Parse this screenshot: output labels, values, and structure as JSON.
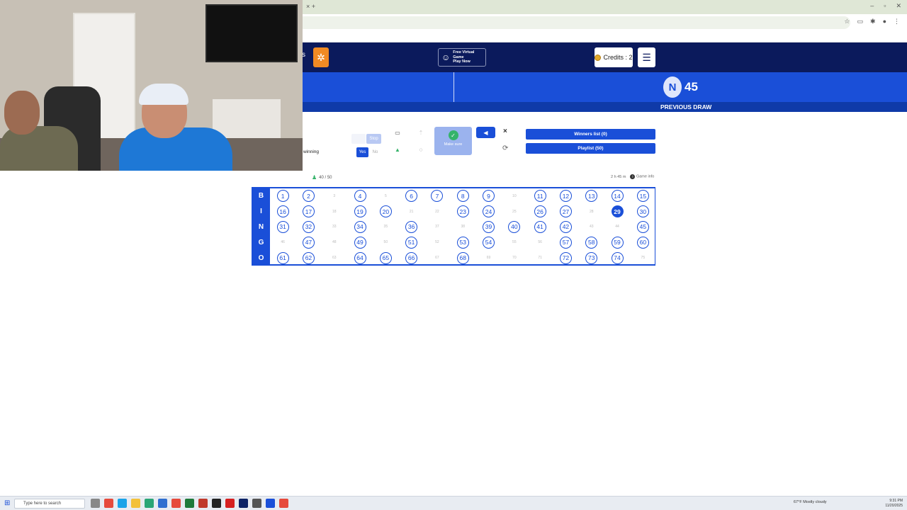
{
  "browser": {
    "tab_controls": "× +",
    "window_controls": [
      "–",
      "▫",
      "✕"
    ]
  },
  "header": {
    "free_game_line1": "Free Virtual Game",
    "free_game_line2": "Play Now",
    "credits_label": "Credits : 2",
    "menu_icon": "hamburger-icon",
    "cut_text": "s"
  },
  "draw": {
    "previous_letter": "N",
    "previous_number": "45",
    "previous_label": "PREVIOUS DRAW"
  },
  "controls": {
    "winning_label": "winning",
    "stop_label": "Stop",
    "yes_label": "Yes",
    "no_label": "No",
    "make_sure_label": "Make sure",
    "close_label": "×",
    "winners_list": "Winners list (0)",
    "playlist": "Playlist (50)",
    "players_count": "40 / 50",
    "time_label": "2 h 45 m",
    "game_info": "Game info"
  },
  "board": {
    "current": 29,
    "rows": [
      {
        "letter": "B",
        "numbers": [
          1,
          2,
          3,
          4,
          5,
          6,
          7,
          8,
          9,
          10,
          11,
          12,
          13,
          14,
          15
        ],
        "called": [
          1,
          2,
          4,
          6,
          7,
          8,
          9,
          11,
          12,
          13,
          14,
          15
        ]
      },
      {
        "letter": "I",
        "numbers": [
          16,
          17,
          18,
          19,
          20,
          21,
          22,
          23,
          24,
          25,
          26,
          27,
          28,
          29,
          30
        ],
        "called": [
          16,
          17,
          19,
          20,
          23,
          24,
          26,
          27,
          29,
          30
        ]
      },
      {
        "letter": "N",
        "numbers": [
          31,
          32,
          33,
          34,
          35,
          36,
          37,
          38,
          39,
          40,
          41,
          42,
          43,
          44,
          45
        ],
        "called": [
          31,
          32,
          34,
          36,
          39,
          40,
          41,
          42,
          45
        ]
      },
      {
        "letter": "G",
        "numbers": [
          46,
          47,
          48,
          49,
          50,
          51,
          52,
          53,
          54,
          55,
          56,
          57,
          58,
          59,
          60
        ],
        "called": [
          47,
          49,
          51,
          53,
          54,
          57,
          58,
          59,
          60
        ]
      },
      {
        "letter": "O",
        "numbers": [
          61,
          62,
          63,
          64,
          65,
          66,
          67,
          68,
          69,
          70,
          71,
          72,
          73,
          74,
          75
        ],
        "called": [
          61,
          62,
          64,
          65,
          66,
          68,
          72,
          73,
          74
        ]
      }
    ]
  },
  "taskbar": {
    "search_placeholder": "Type here to search",
    "weather": "67°F Mostly cloudy",
    "time": "9:31 PM",
    "date": "11/20/2025"
  },
  "colors": {
    "header_navy": "#0b1a5c",
    "bingo_blue": "#1a4fd8",
    "accent_orange": "#f08a24"
  }
}
